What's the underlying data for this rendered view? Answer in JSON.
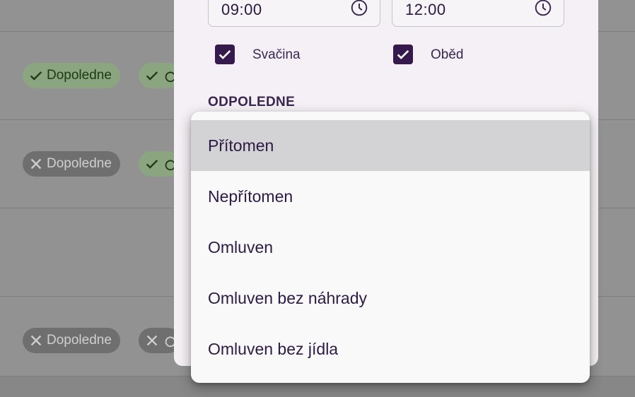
{
  "list": {
    "chips": [
      {
        "label": "Dopoledne",
        "state": "ok"
      },
      {
        "label": "Dopoledne",
        "state": "no"
      },
      {
        "label": "Dopoledne",
        "state": "no"
      }
    ]
  },
  "dialog": {
    "time_from": "09:00",
    "time_to": "12:00",
    "snack_label": "Svačina",
    "lunch_label": "Oběd",
    "section_title": "ODPOLEDNE"
  },
  "menu": {
    "items": [
      {
        "label": "Přítomen"
      },
      {
        "label": "Nepřítomen"
      },
      {
        "label": "Omluven"
      },
      {
        "label": "Omluven bez náhrady"
      },
      {
        "label": "Omluven bez jídla"
      }
    ]
  },
  "colors": {
    "accent": "#361a4d",
    "present_chip": "#8aa57f",
    "absent_chip": "#6f6f6f",
    "menu_selected": "#d3d2d4"
  }
}
